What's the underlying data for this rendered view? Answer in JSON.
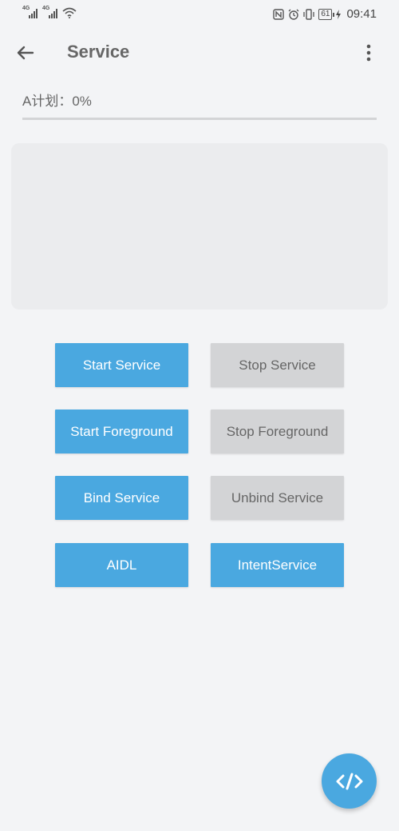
{
  "status_bar": {
    "network_1": "4G",
    "network_2": "4G",
    "battery": "61",
    "time": "09:41",
    "icons": [
      "nfc-icon",
      "alarm-icon",
      "vibrate-icon",
      "charging-icon"
    ]
  },
  "toolbar": {
    "title": "Service",
    "back_icon": "arrow-left-icon",
    "more_icon": "more-vert-icon"
  },
  "progress": {
    "label": "A计划：0%",
    "value": 0
  },
  "buttons": {
    "start_service": "Start Service",
    "stop_service": "Stop Service",
    "start_foreground": "Start Foreground",
    "stop_foreground": "Stop Foreground",
    "bind_service": "Bind Service",
    "unbind_service": "Unbind Service",
    "aidl": "AIDL",
    "intent_service": "IntentService"
  },
  "fab": {
    "icon": "code-icon"
  },
  "colors": {
    "accent": "#4aa8e0",
    "disabled": "#d3d4d6",
    "background": "#f3f4f6"
  }
}
